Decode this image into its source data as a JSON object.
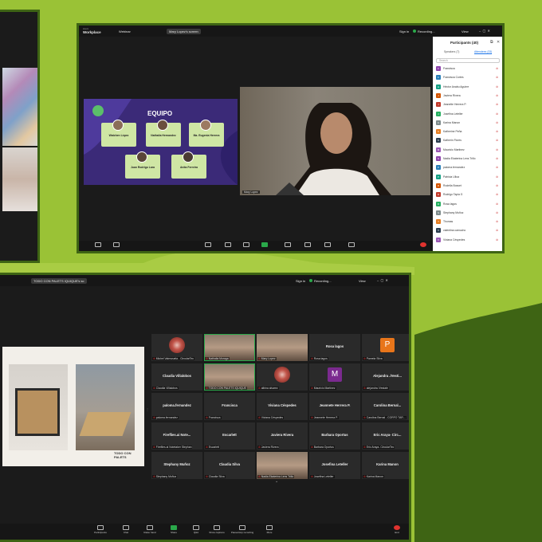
{
  "colors": {
    "background": "#9ac236",
    "frame": "#3e6414",
    "window": "#1b1b1b",
    "end_button": "#e0332f",
    "accent_blue": "#1a73e8"
  },
  "window_b": {
    "brand": "Workplace",
    "tab_home": "Webinar",
    "tab_share": "Mary Lopez's screen",
    "sign_in": "Sign in",
    "recording": "Recording...",
    "view": "View",
    "slide": {
      "title": "EQUIPO",
      "members": [
        "Watchen López",
        "Nathalia Hernandez",
        "Ma. Eugenia Herrera",
        "Juan Rodrigo Lara",
        "Anita Ferreira"
      ]
    },
    "video_name": "Mary Lopez",
    "panel": {
      "title": "Participants (40)",
      "tab_speakers": "Speakers (7)",
      "tab_attendees": "Attendees (33)",
      "search_placeholder": "Search",
      "participants": [
        "Francisca",
        "Francisca Cortes",
        "Héctor Anabu Aguirre",
        "Javiera Rivera",
        "Jeanette Herrera P.",
        "Josefina Leteller",
        "Karina Manon",
        "Katherine Peña",
        "Katherin Flores",
        "Mauricio Martinez",
        "Nadia Ekaterina Lens Trillo",
        "paloma.fernandez",
        "Patricia Ulloa",
        "Rodella Bosset",
        "Rodrigo Tapia G",
        "Rosa lagos",
        "Stephany Muñoz",
        "Thomas",
        "valentina camucho",
        "Viviana Céspedes"
      ]
    }
  },
  "window_c": {
    "tab_label": "TODO CON PALETS IQUIQUE's sc",
    "sign_in": "Sign in",
    "recording": "Recording...",
    "view": "View",
    "slide_brand": "TODO CON PALETS",
    "tiles": [
      {
        "name": "",
        "label": "Michel Valenzuela - CircularTec",
        "avatar": "logo"
      },
      {
        "name": "",
        "label": "Nathalia Moraga",
        "avatar": "video"
      },
      {
        "name": "",
        "label": "Mary Lopez",
        "avatar": "video"
      },
      {
        "name": "Rosa lagos",
        "label": "Rosa lagos",
        "avatar": ""
      },
      {
        "name": "",
        "label": "Pamela Silva",
        "avatar": "P"
      },
      {
        "name": "Claudia Villalobos",
        "label": "Claudia Villalobos",
        "avatar": ""
      },
      {
        "name": "",
        "label": "TODO CON PALETS IQUIQUE",
        "avatar": "video"
      },
      {
        "name": "",
        "label": "albina alvarez",
        "avatar": "logo"
      },
      {
        "name": "",
        "label": "Mauricio Martinez",
        "avatar": "M"
      },
      {
        "name": "Alejandra ./Vesti...",
        "label": "alejandra /Vestale",
        "avatar": ""
      },
      {
        "name": "paloma.fernandez",
        "label": "paloma.fernandez",
        "avatar": ""
      },
      {
        "name": "Francisca",
        "label": "Francisca",
        "avatar": ""
      },
      {
        "name": "Viviana Céspedes",
        "label": "Viviana Céspedes",
        "avatar": ""
      },
      {
        "name": "Jeannete Herrera P.",
        "label": "Jeannete Herrera P.",
        "avatar": ""
      },
      {
        "name": "Carolina Bernal...",
        "label": "Carolina Bernal - CORFO TAR...",
        "avatar": ""
      },
      {
        "name": "Fireflies.ai Note...",
        "label": "Fireflies.ai Notetaker Stephan",
        "avatar": ""
      },
      {
        "name": "Escarlett",
        "label": "Escarlett",
        "avatar": ""
      },
      {
        "name": "Javiera Rivera",
        "label": "Javiera Rivera",
        "avatar": ""
      },
      {
        "name": "Barbara Oportus",
        "label": "Barbara Oportus",
        "avatar": ""
      },
      {
        "name": "Eric Araya- Circ...",
        "label": "Eric Araya- CircularTec",
        "avatar": ""
      },
      {
        "name": "Stephany Muñoz",
        "label": "Stephany Muñoz",
        "avatar": ""
      },
      {
        "name": "Claudia Silva",
        "label": "Claudia Silva",
        "avatar": ""
      },
      {
        "name": "",
        "label": "Nadia Ekaterina Lens Trillo",
        "avatar": "video"
      },
      {
        "name": "Josefina Leteller",
        "label": "Josefina Leteller",
        "avatar": ""
      },
      {
        "name": "Karina Manon",
        "label": "Karina Manon",
        "avatar": ""
      }
    ],
    "controls": [
      "Participants",
      "Chat",
      "Raise hand",
      "Share",
      "Q&A",
      "Show captions",
      "Pause/stop recording",
      "More",
      "End"
    ]
  },
  "window_b_controls": [
    "Audio",
    "Video",
    "Participants",
    "Chat",
    "React",
    "Share",
    "Apps",
    "Record",
    "Captions",
    "More",
    "Leave"
  ]
}
